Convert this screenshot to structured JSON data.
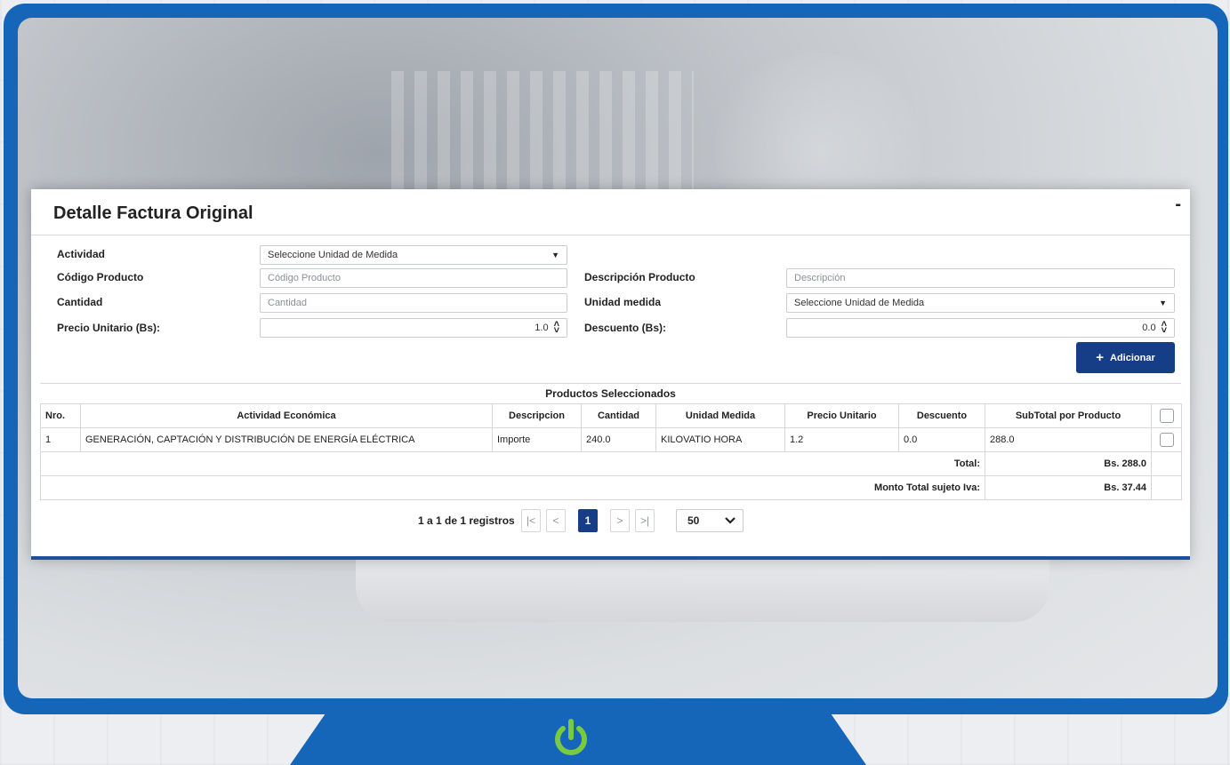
{
  "panel": {
    "title": "Detalle Factura Original",
    "collapse_symbol": "-"
  },
  "form": {
    "actividad": {
      "label": "Actividad",
      "value": "Seleccione Unidad de Medida"
    },
    "codigo_producto": {
      "label": "Código Producto",
      "placeholder": "Código Producto"
    },
    "descripcion_producto": {
      "label": "Descripción Producto",
      "placeholder": "Descripción"
    },
    "cantidad": {
      "label": "Cantidad",
      "placeholder": "Cantidad"
    },
    "unidad_medida": {
      "label": "Unidad medida",
      "value": "Seleccione Unidad de Medida"
    },
    "precio_unitario": {
      "label": "Precio Unitario (Bs):",
      "value": "1.0"
    },
    "descuento": {
      "label": "Descuento (Bs):",
      "value": "0.0"
    },
    "add_button": {
      "label": "Adicionar",
      "icon": "plus-icon"
    }
  },
  "table": {
    "title": "Productos Seleccionados",
    "columns": [
      "Nro.",
      "Actividad Económica",
      "Descripcion",
      "Cantidad",
      "Unidad Medida",
      "Precio Unitario",
      "Descuento",
      "SubTotal por Producto"
    ],
    "rows": [
      [
        "1",
        "GENERACIÓN, CAPTACIÓN Y DISTRIBUCIÓN DE ENERGÍA ELÉCTRICA",
        "Importe",
        "240.0",
        "KILOVATIO HORA",
        "1.2",
        "0.0",
        "288.0"
      ]
    ],
    "total_label": "Total:",
    "total_value": "Bs. 288.0",
    "iva_label": "Monto Total sujeto Iva:",
    "iva_value": "Bs. 37.44"
  },
  "pagination": {
    "summary": "1 a 1 de 1 registros",
    "first": "|<",
    "prev": "<",
    "current": "1",
    "next": ">",
    "last": ">|",
    "page_size": "50"
  },
  "colors": {
    "frame": "#1565b9",
    "primary_button": "#153e86",
    "power_icon": "#7ac943"
  }
}
